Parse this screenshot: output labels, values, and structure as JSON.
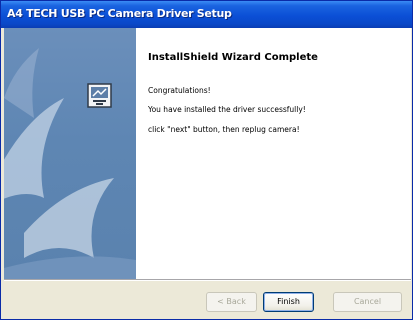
{
  "window": {
    "title": "A4 TECH USB PC Camera Driver Setup"
  },
  "wizard": {
    "headline": "InstallShield Wizard Complete",
    "message_line1": "Congratulations!",
    "message_line2": "You have installed the driver successfully!",
    "message_line3": "click \"next\" button, then replug camera!"
  },
  "buttons": {
    "back_label": "< Back",
    "finish_label": "Finish",
    "cancel_label": "Cancel"
  },
  "icons": {
    "left_panel_icon": "setup-monitor-icon"
  },
  "colors": {
    "titlebar": "#0b4fd6",
    "left_panel": "#5e86b3",
    "window_bg": "#ece9d8"
  }
}
